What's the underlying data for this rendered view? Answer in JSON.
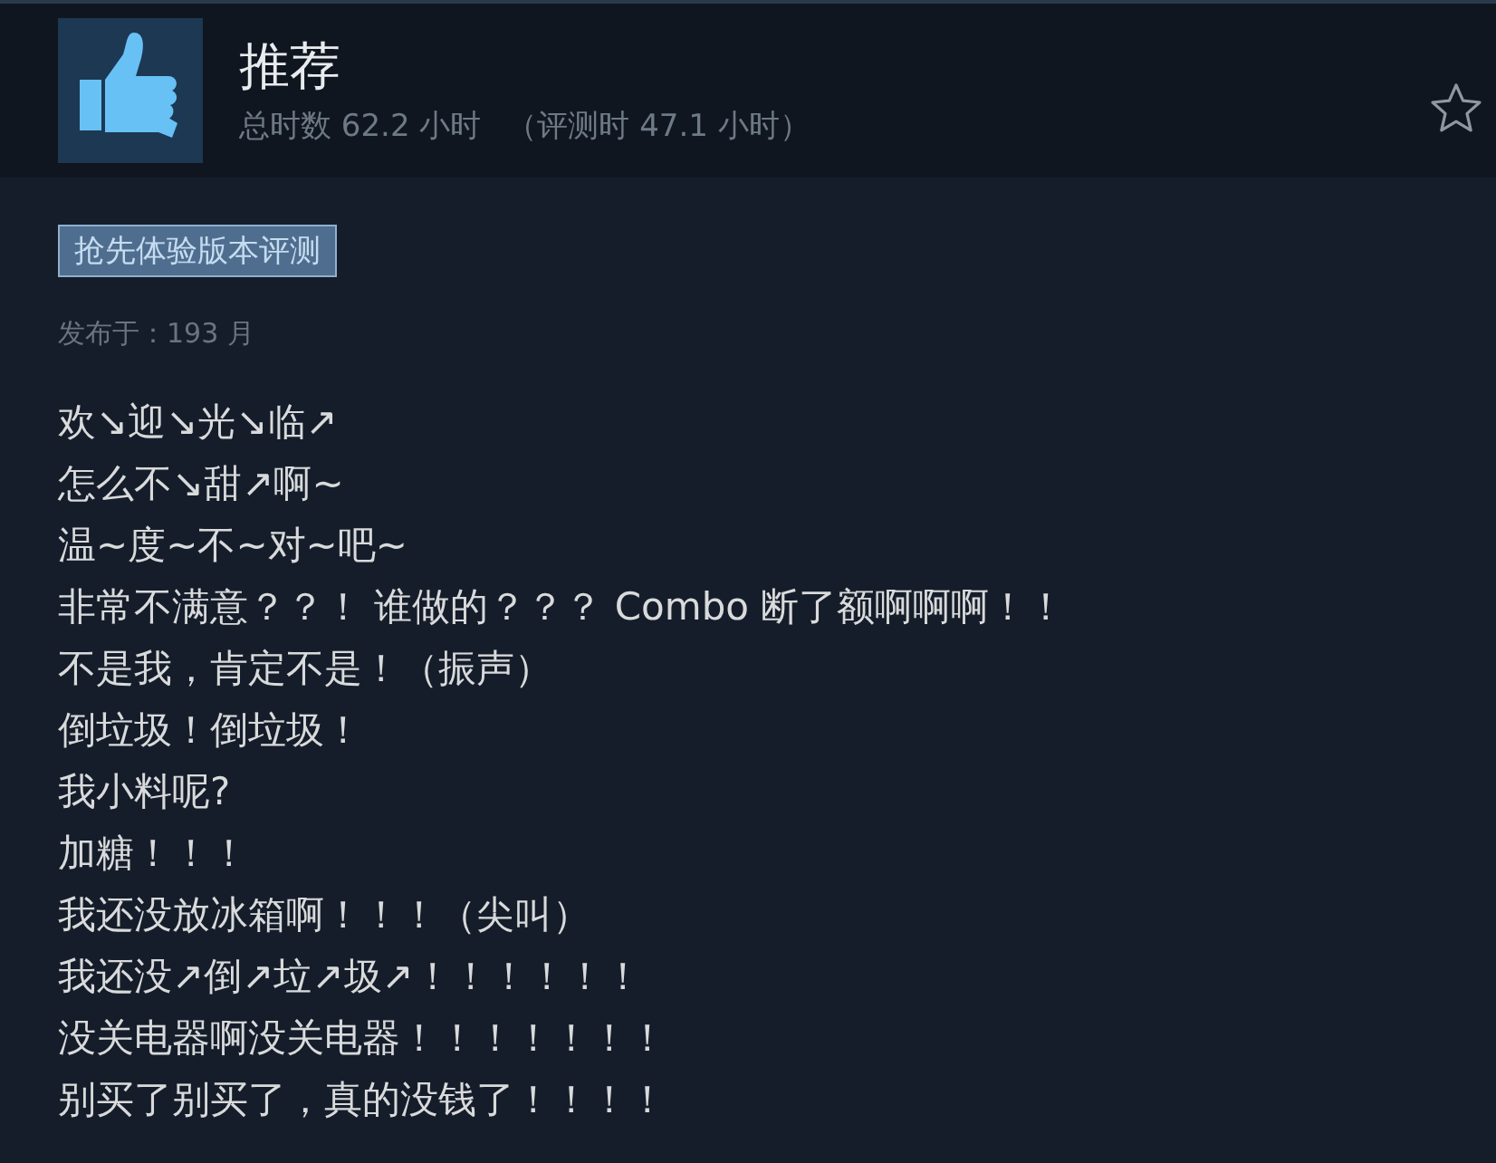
{
  "review": {
    "title": "推荐",
    "hours": "总时数 62.2 小时",
    "review_hours": "（评测时 47.1 小时）",
    "recommended": true
  },
  "badge": "抢先体验版本评测",
  "posted": "发布于：193 月",
  "lines": [
    "欢↘迎↘光↘临↗",
    "怎么不↘甜↗啊~",
    "温~度~不~对~吧~",
    "非常不满意？？！ 谁做的？？？ Combo 断了额啊啊啊！！",
    "不是我，肯定不是！（振声）",
    "倒垃圾！倒垃圾！",
    "我小料呢?",
    "加糖！！！",
    "我还没放冰箱啊！！！（尖叫）",
    "我还没↗倒↗垃↗圾↗！！！！！！",
    "没关电器啊没关电器！！！！！！！",
    "别买了别买了，真的没钱了！！！！"
  ]
}
